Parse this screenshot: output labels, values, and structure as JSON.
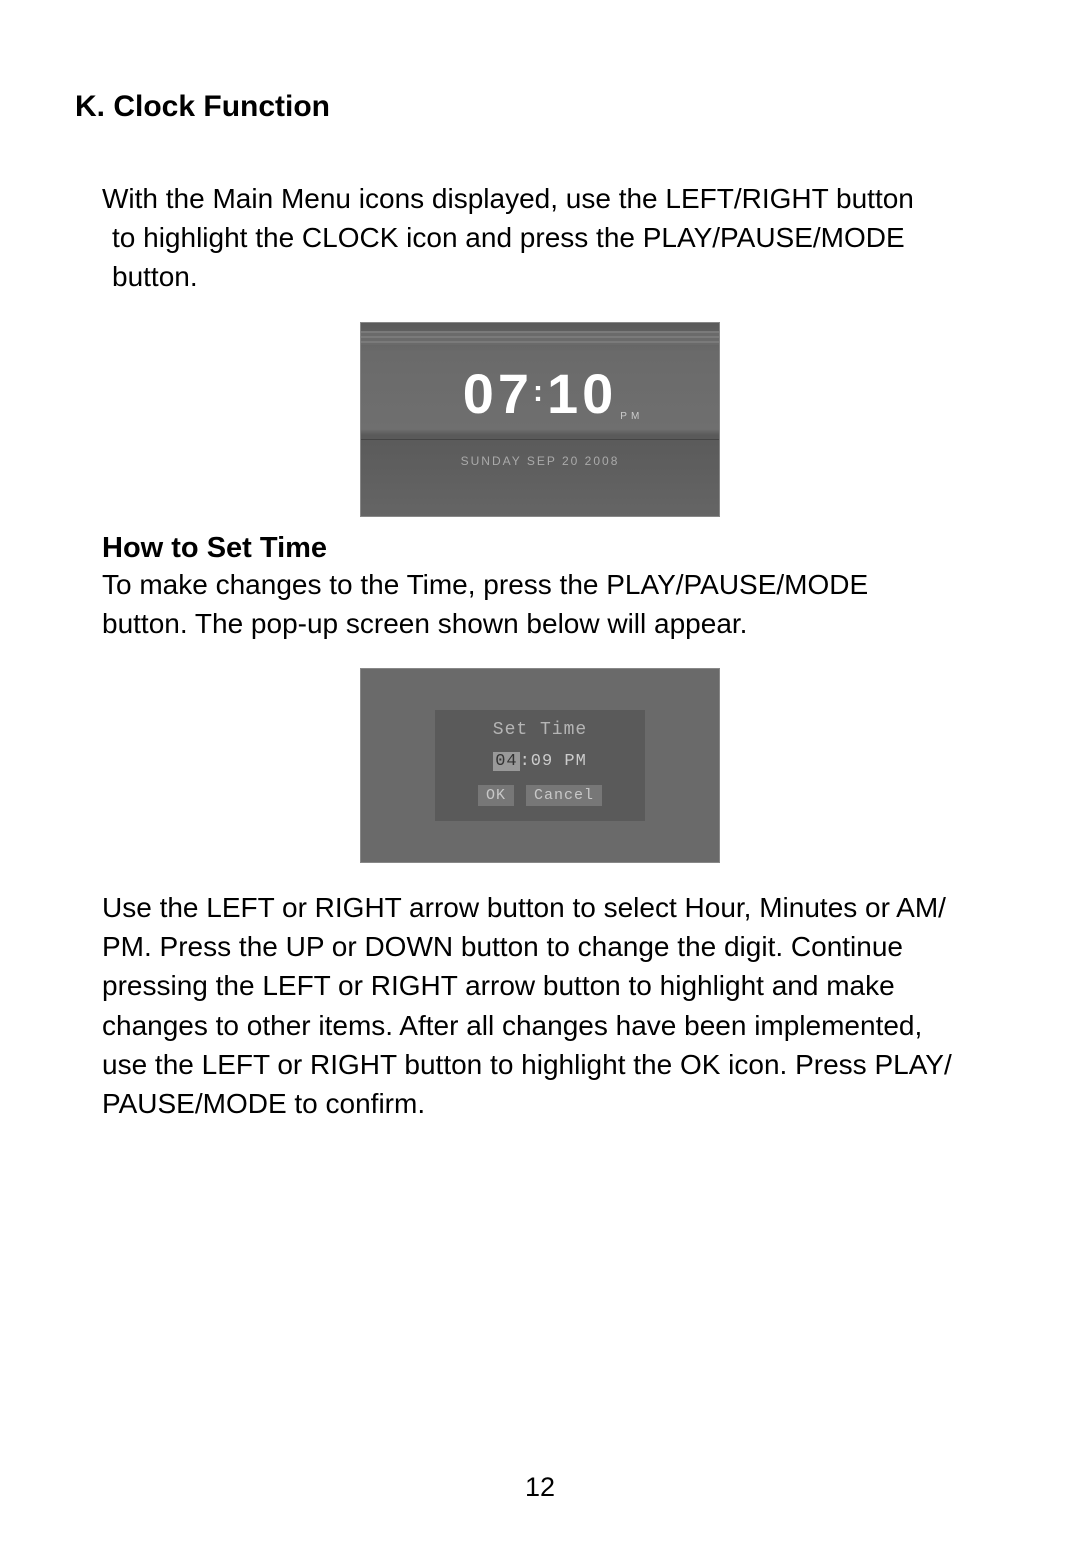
{
  "section": {
    "heading": "K. Clock Function",
    "intro_line1": "With the Main Menu icons displayed, use the LEFT/RIGHT button",
    "intro_line2": " to highlight the CLOCK icon and press the PLAY/PAUSE/MODE",
    "intro_line3": " button."
  },
  "clock_screen": {
    "hour": "07",
    "colon": ":",
    "minute": "10",
    "ampm": "PM",
    "date": "SUNDAY    SEP   20 2008"
  },
  "set_time_section": {
    "heading": "How to Set Time",
    "line1": "To make changes to the Time, press the PLAY/PAUSE/MODE",
    "line2": "button. The  pop-up screen shown below will appear."
  },
  "set_time_dialog": {
    "title": "Set Time",
    "hour": "04",
    "sep": ":",
    "minute": "09",
    "ampm": "PM",
    "ok": "OK",
    "cancel": "Cancel"
  },
  "instructions": {
    "line1": "Use the  LEFT or RIGHT arrow button to select Hour, Minutes or AM/",
    "line2": "PM. Press the UP or DOWN button to change the digit. Continue",
    "line3": "pressing the LEFT or RIGHT arrow button to highlight and make",
    "line4": "changes to other items.  After all changes have been implemented,",
    "line5": "use the LEFT or RIGHT button to highlight the OK icon. Press PLAY/",
    "line6": "PAUSE/MODE to confirm."
  },
  "page_number": "12"
}
